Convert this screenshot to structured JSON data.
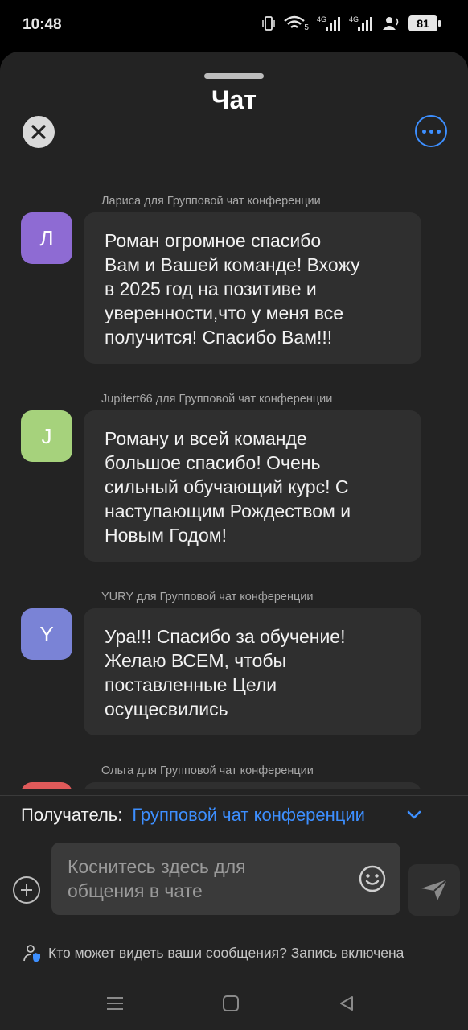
{
  "status_bar": {
    "time": "10:48",
    "battery": "81",
    "network_labels": [
      "4G",
      "4G"
    ],
    "wifi_badge": "5"
  },
  "header": {
    "title": "Чат"
  },
  "messages": [
    {
      "sender": "Лариса для Групповой чат конференции",
      "avatar_letter": "Л",
      "avatar_color": "#8e6bd3",
      "lines": [
        "Роман огромное спасибо",
        "Вам и Вашей команде! Вхожу",
        "в 2025 год на позитиве и",
        "уверенности,что у меня все",
        "получится! Спасибо Вам!!!"
      ]
    },
    {
      "sender": "Jupitert66 для Групповой чат конференции",
      "avatar_letter": "J",
      "avatar_color": "#a6d27c",
      "lines": [
        "Роману и всей команде",
        "большое спасибо! Очень",
        "сильный обучающий курс! С",
        "наступающим Рождеством и",
        "Новым Годом!"
      ]
    },
    {
      "sender": "YURY для Групповой чат конференции",
      "avatar_letter": "Y",
      "avatar_color": "#7a83d6",
      "lines": [
        "Ура!!! Спасибо за обучение!",
        "Желаю ВСЕМ, чтобы",
        "поставленные Цели",
        "осущесвились"
      ]
    },
    {
      "sender": "Ольга для Групповой чат конференции",
      "avatar_letter": "",
      "avatar_color": "#e05a5a",
      "lines": []
    }
  ],
  "recipient": {
    "label": "Получатель:",
    "value": "Групповой чат конференции"
  },
  "composer": {
    "placeholder": "Коснитесь здесь для общения в чате"
  },
  "privacy": {
    "text": "Кто может видеть ваши сообщения? Запись включена"
  },
  "colors": {
    "accent": "#3d8fff",
    "sheet_bg": "#232323",
    "bubble_bg": "#2f2f2f"
  },
  "icons": {
    "close": "close-icon",
    "more": "more-options-icon",
    "chevron": "chevron-down-icon",
    "add": "add-icon",
    "emoji": "emoji-icon",
    "send": "send-icon",
    "privacy": "person-shield-icon"
  }
}
